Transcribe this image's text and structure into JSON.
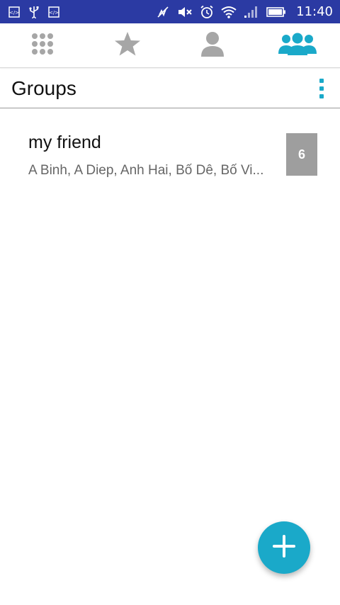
{
  "status_bar": {
    "time": "11:40",
    "icons": [
      "code-icon",
      "usb-icon",
      "code-icon",
      "nfc-off-icon",
      "mute-icon",
      "alarm-icon",
      "wifi-icon",
      "signal-icon",
      "battery-icon"
    ]
  },
  "tabs": [
    {
      "name": "dialpad",
      "icon": "dialpad-icon",
      "active": false
    },
    {
      "name": "favorites",
      "icon": "star-icon",
      "active": false
    },
    {
      "name": "contacts",
      "icon": "person-icon",
      "active": false
    },
    {
      "name": "groups",
      "icon": "group-icon",
      "active": true
    }
  ],
  "header": {
    "title": "Groups"
  },
  "groups": [
    {
      "name": "my friend",
      "members": "A Binh, A Diep, Anh Hai, Bố Dê, Bố Vi...",
      "count": "6"
    }
  ],
  "colors": {
    "status_bar": "#2b3aa3",
    "accent": "#1aa9c9",
    "inactive_icon": "#a6a6a6",
    "count_badge": "#9e9e9e"
  }
}
